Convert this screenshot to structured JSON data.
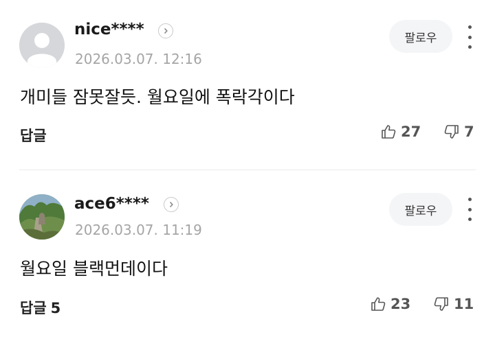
{
  "comments": [
    {
      "nickname": "nice****",
      "date": "2026.03.07. 12:16",
      "follow_label": "팔로우",
      "text": "개미들 잠못잘듯. 월요일에 폭락각이다",
      "reply_label": "답글",
      "reply_count": "",
      "likes": "27",
      "dislikes": "7",
      "avatar": "default-person-icon"
    },
    {
      "nickname": "ace6****",
      "date": "2026.03.07. 11:19",
      "follow_label": "팔로우",
      "text": "월요일 블랙먼데이다",
      "reply_label": "답글",
      "reply_count": "5",
      "likes": "23",
      "dislikes": "11",
      "avatar": "nature-photo"
    }
  ],
  "colors": {
    "date_gray": "#a5a5a5",
    "follow_bg": "#f4f5f7",
    "avatar_default": "#d6d7db"
  }
}
